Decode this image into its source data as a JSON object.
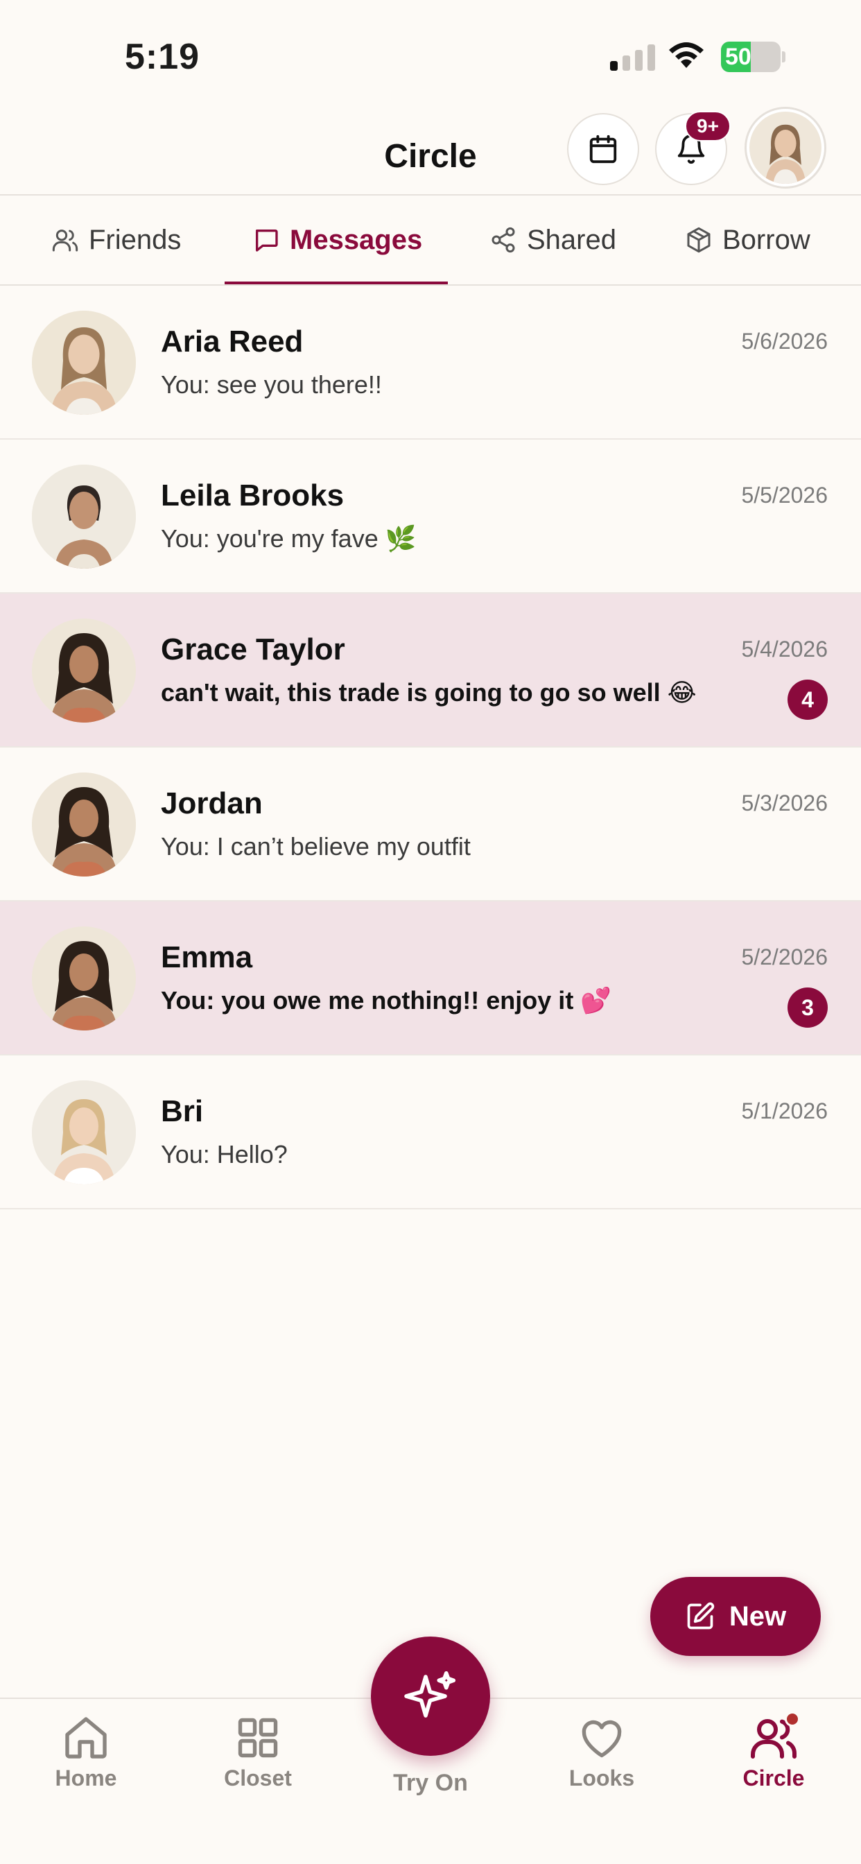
{
  "status_bar": {
    "time": "5:19",
    "battery_percent": "50",
    "battery_level": 0.5
  },
  "header": {
    "title": "Circle",
    "notification_badge": "9+"
  },
  "tabs": [
    {
      "label": "Friends",
      "icon": "friends-icon",
      "active": false
    },
    {
      "label": "Messages",
      "icon": "message-icon",
      "active": true
    },
    {
      "label": "Shared",
      "icon": "share-icon",
      "active": false
    },
    {
      "label": "Borrow",
      "icon": "box-icon",
      "active": false
    }
  ],
  "conversations": [
    {
      "name": "Aria Reed",
      "date": "5/6/2026",
      "preview": "You: see you there!!",
      "unread": false,
      "unread_count": ""
    },
    {
      "name": "Leila Brooks",
      "date": "5/5/2026",
      "preview": "You: you're my fave 🌿",
      "unread": false,
      "unread_count": ""
    },
    {
      "name": "Grace Taylor",
      "date": "5/4/2026",
      "preview": "can't wait, this trade is going to go so well 😂",
      "unread": true,
      "unread_count": "4"
    },
    {
      "name": "Jordan",
      "date": "5/3/2026",
      "preview": "You: I can’t believe my outfit",
      "unread": false,
      "unread_count": ""
    },
    {
      "name": "Emma",
      "date": "5/2/2026",
      "preview": "You: you owe me nothing!! enjoy it 💕",
      "unread": true,
      "unread_count": "3"
    },
    {
      "name": "Bri",
      "date": "5/1/2026",
      "preview": "You: Hello?",
      "unread": false,
      "unread_count": ""
    }
  ],
  "fab": {
    "label": "New"
  },
  "bottom_nav": {
    "home": "Home",
    "closet": "Closet",
    "try_on": "Try On",
    "looks": "Looks",
    "circle": "Circle"
  },
  "colors": {
    "accent": "#8A0A3C",
    "background": "#FDFAF6",
    "unread_row": "#F2E2E6"
  }
}
